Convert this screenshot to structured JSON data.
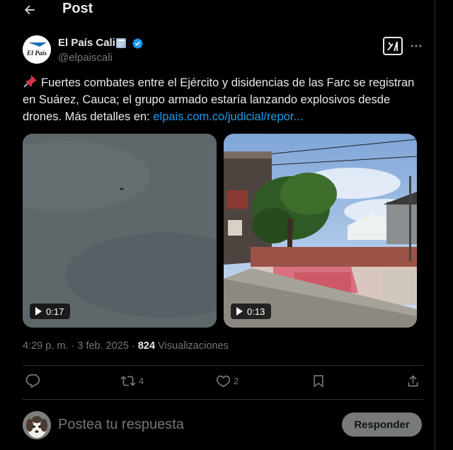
{
  "header": {
    "title": "Post"
  },
  "author": {
    "name": "El País Cali",
    "handle": "@elpaiscali",
    "logo_text": "El País"
  },
  "tweet": {
    "text": "Fuertes combates entre el Ejército y disidencias de las Farc se registran en Suárez, Cauca; el grupo armado estaría lanzando explosivos desde drones. Más detalles en: ",
    "link": "elpais.com.co/judicial/repor..."
  },
  "media": [
    {
      "duration": "0:17"
    },
    {
      "duration": "0:13"
    }
  ],
  "meta": {
    "time": "4:29 p. m.",
    "date": "3 feb. 2025",
    "views_count": "824",
    "views_label": "Visualizaciones"
  },
  "actions": {
    "retweets": "4",
    "likes": "2"
  },
  "reply": {
    "placeholder": "Postea tu respuesta",
    "button": "Responder"
  },
  "colors": {
    "accent": "#1d9bf0",
    "background": "#000000",
    "muted": "#71767b",
    "divider": "#2f3336"
  }
}
